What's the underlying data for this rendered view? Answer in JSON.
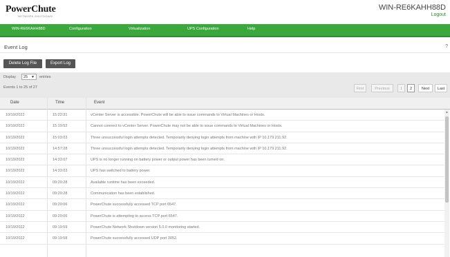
{
  "header": {
    "logo": "PowerChute",
    "logo_tagline": "NETWORK SHUTDOWN",
    "hostname": "WIN-RE6KAHH88D",
    "logout": "Logout"
  },
  "nav": [
    "WIN-RE6KAHH88D",
    "Configuration",
    "Virtualization",
    "UPS Configuration",
    "Help"
  ],
  "page": {
    "title": "Event Log",
    "help": "?"
  },
  "buttons": {
    "delete": "Delete Log File",
    "export": "Export Log"
  },
  "controls": {
    "display_label": "Display",
    "page_size": "25",
    "entries_label": "entries",
    "info": "Events 1 to 25 of 27",
    "pager": {
      "first": "First",
      "previous": "Previous",
      "page1": "1",
      "page2": "2",
      "next": "Next",
      "last": "Last"
    }
  },
  "table": {
    "headers": [
      "Date",
      "Time",
      "Event"
    ],
    "rows": [
      [
        "10/19/2022",
        "15:22:31",
        "vCenter Server is accessible. PowerChute will be able to issue commands to Virtual Machines or Hosts."
      ],
      [
        "10/19/2022",
        "15:19:52",
        "Cannot connect to vCenter Server. PowerChute may not be able to issue commands to Virtual Machines or Hosts."
      ],
      [
        "10/19/2022",
        "15:03:03",
        "Three unsuccessful login attempts detected. Temporarily denying login attempts from machine with IP 10.179.211.92."
      ],
      [
        "10/19/2022",
        "14:57:28",
        "Three unsuccessful login attempts detected. Temporarily denying login attempts from machine with IP 10.179.211.92."
      ],
      [
        "10/19/2022",
        "14:33:07",
        "UPS is no longer running on battery power or output power has been turned on."
      ],
      [
        "10/19/2022",
        "14:33:03",
        "UPS has switched to battery power."
      ],
      [
        "10/19/2022",
        "09:20:28",
        "Available runtime has been exceeded."
      ],
      [
        "10/19/2022",
        "09:20:28",
        "Communication has been established."
      ],
      [
        "10/19/2022",
        "09:20:06",
        "PowerChute successfully accessed TCP port 6547."
      ],
      [
        "10/19/2022",
        "09:20:06",
        "PowerChute is attempting to access TCP port 6547."
      ],
      [
        "10/19/2022",
        "09:19:59",
        "PowerChute Network Shutdown version 5.0.0 monitoring started."
      ],
      [
        "10/19/2022",
        "09:19:58",
        "PowerChute successfully accessed UDP port 3052."
      ]
    ]
  },
  "colors": {
    "nav_green": "#3aa83c",
    "button_dark": "#555555"
  }
}
